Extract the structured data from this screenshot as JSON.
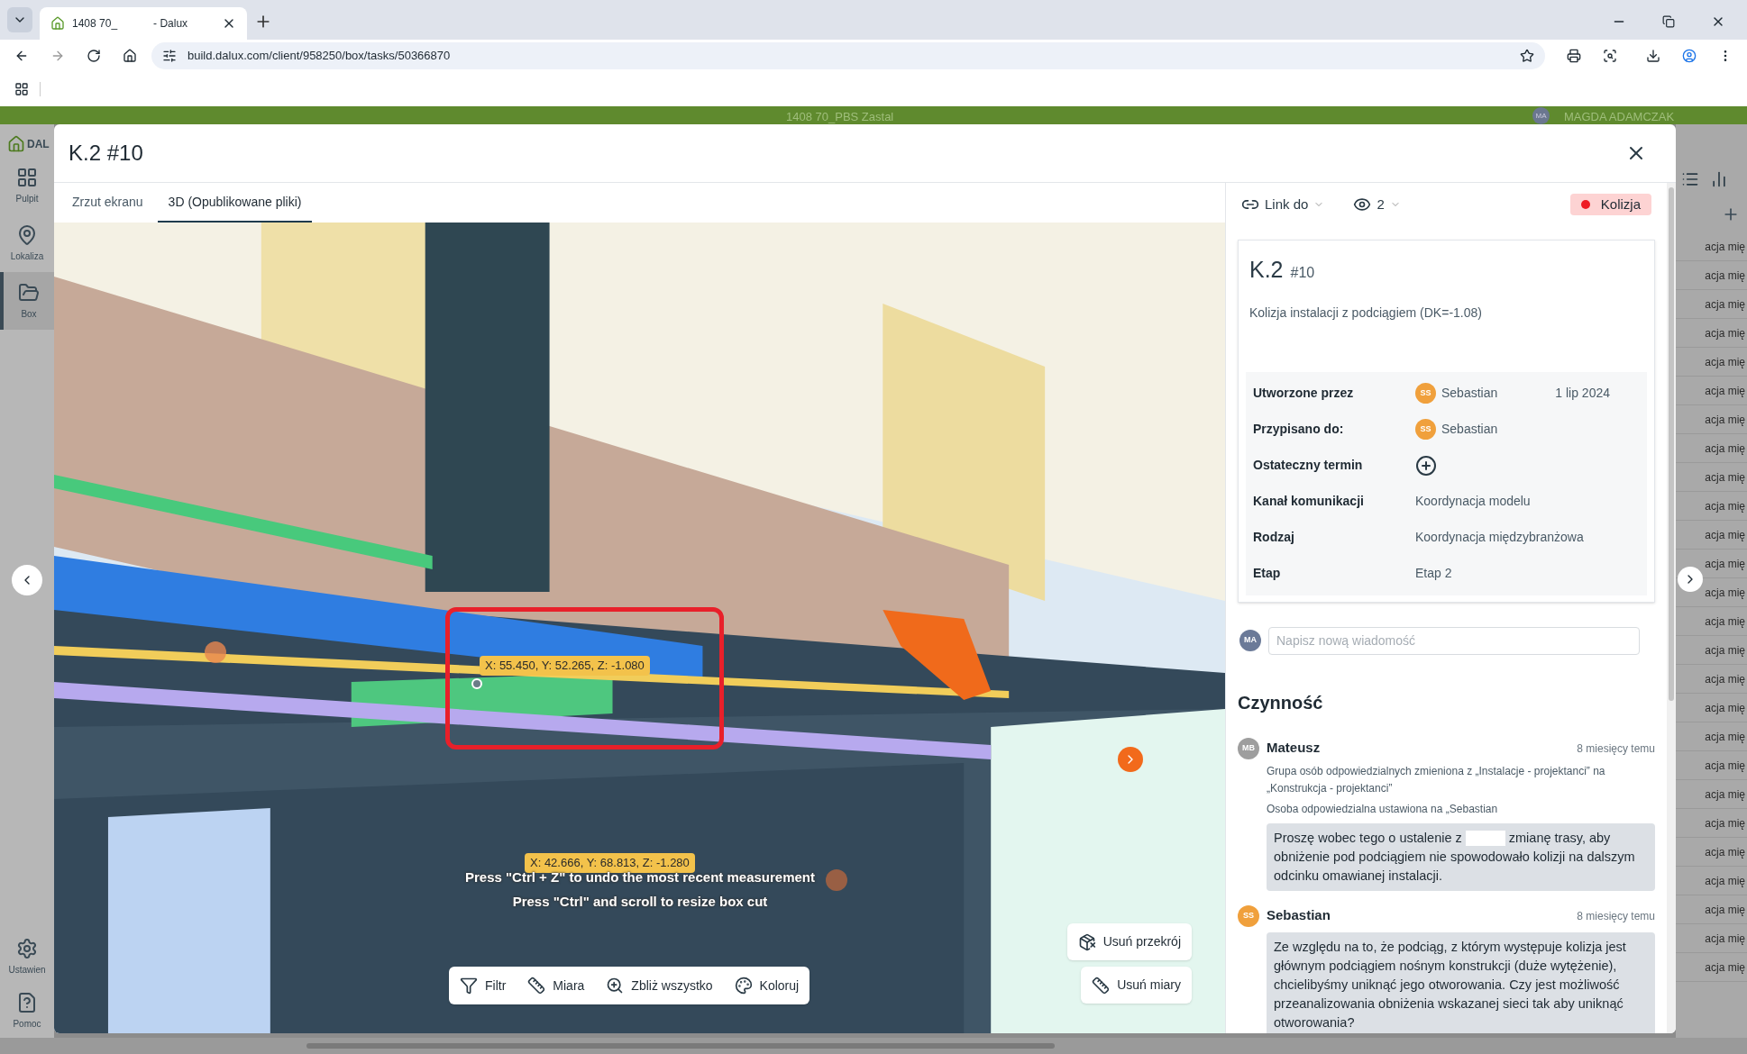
{
  "browser": {
    "tab": {
      "title_parts": [
        "1408 70_",
        "- Dalux"
      ]
    },
    "url": "build.dalux.com/client/958250/box/tasks/50366870"
  },
  "app_header": {
    "project": "1408 70_PBS Zastal",
    "user_initials": "MA",
    "user": "MAGDA ADAMCZAK"
  },
  "sidebar": {
    "logo": "DAL",
    "items": [
      {
        "label": "Pulpit",
        "kind": "grid",
        "selected": false
      },
      {
        "label": "Lokaliza",
        "kind": "pin",
        "selected": false
      },
      {
        "label": "Box",
        "kind": "folder",
        "selected": true
      }
    ],
    "bottom_items": [
      {
        "label": "Ustawien",
        "kind": "gear"
      },
      {
        "label": "Pomoc",
        "kind": "help"
      }
    ]
  },
  "background_list": {
    "rows": [
      "acja mię",
      "acja mię",
      "acja mię",
      "acja mię",
      "acja mię",
      "acja mię",
      "acja mię",
      "acja mię",
      "acja mię",
      "acja mię",
      "acja mię",
      "acja mię",
      "acja mię",
      "acja mię",
      "acja mię",
      "acja mię",
      "acja mię",
      "acja mię",
      "acja mię",
      "acja mię",
      "acja mię",
      "acja mię",
      "acja mię",
      "acja mię",
      "acja mię",
      "acja mię"
    ]
  },
  "modal": {
    "title": "K.2 #10",
    "tabs": [
      {
        "label": "Zrzut ekranu",
        "selected": false
      },
      {
        "label": "3D (Opublikowane pliki)",
        "selected": true
      }
    ],
    "viewer": {
      "measurements": [
        "X: 55.450, Y: 52.265, Z: -1.080",
        "X: 42.666, Y: 68.813, Z: -1.280"
      ],
      "hints": [
        "Press \"Ctrl + Z\" to undo the most recent measurement",
        "Press \"Ctrl\" and scroll to resize box cut"
      ],
      "toolbar": [
        {
          "label": "Filtr",
          "kind": "filter"
        },
        {
          "label": "Miara",
          "kind": "measure"
        },
        {
          "label": "Zbliż wszystko",
          "kind": "zoom"
        },
        {
          "label": "Koloruj",
          "kind": "color"
        }
      ],
      "actions": [
        {
          "label": "Usuń przekrój",
          "kind": "section"
        },
        {
          "label": "Usuń miary",
          "kind": "measure"
        }
      ]
    },
    "panel": {
      "link": "Link do",
      "watchers": "2",
      "status": {
        "label": "Kolizja",
        "color": "#ee1c25"
      },
      "card": {
        "title": "K.2",
        "number": "#10",
        "description": "Kolizja instalacji z podciągiem (DK=-1.08)",
        "fields": [
          {
            "label": "Utworzone przez",
            "kind": "person",
            "initials": "SS",
            "name": "Sebastian",
            "date": "1 lip 2024"
          },
          {
            "label": "Przypisano do:",
            "kind": "person",
            "initials": "SS",
            "name": "Sebastian"
          },
          {
            "label": "Ostateczny termin",
            "kind": "add"
          },
          {
            "label": "Kanał komunikacji",
            "kind": "text",
            "value": "Koordynacja modelu"
          },
          {
            "label": "Rodzaj",
            "kind": "text",
            "value": "Koordynacja międzybranżowa"
          },
          {
            "label": "Etap",
            "kind": "text",
            "value": "Etap 2"
          }
        ]
      },
      "comment": {
        "initials": "MA",
        "placeholder": "Napisz nową wiadomość"
      },
      "activity": {
        "heading": "Czynność",
        "entries": [
          {
            "author": "Mateusz",
            "initials": "MB",
            "color": "#9e9e9e",
            "time": "8 miesięcy temu",
            "events": [
              {
                "text": "Grupa osób odpowiedzialnych zmieniona z „Instalacje - projektanci” na „Konstrukcja - projektanci”"
              },
              {
                "text": "Osoba odpowiedzialna ustawiona na „Sebastian"
              }
            ],
            "message_parts": [
              "Proszę wobec tego o ustalenie z",
              "zmianę trasy, aby obniżenie pod podciągiem nie spowodowało kolizji na dalszym odcinku omawianej instalacji."
            ]
          },
          {
            "author": "Sebastian",
            "initials": "SS",
            "color": "#f0a03c",
            "time": "8 miesięcy temu",
            "message_parts": [
              "Ze względu na to, że podciąg, z którym występuje kolizja jest głównym podciągiem nośnym konstrukcji (duże wytężenie), chcielibyśmy uniknąć jego otworowania.  Czy jest możliwość przeanalizowania obniżenia wskazanej sieci tak aby uniknąć otworowania?"
            ]
          }
        ]
      }
    }
  }
}
